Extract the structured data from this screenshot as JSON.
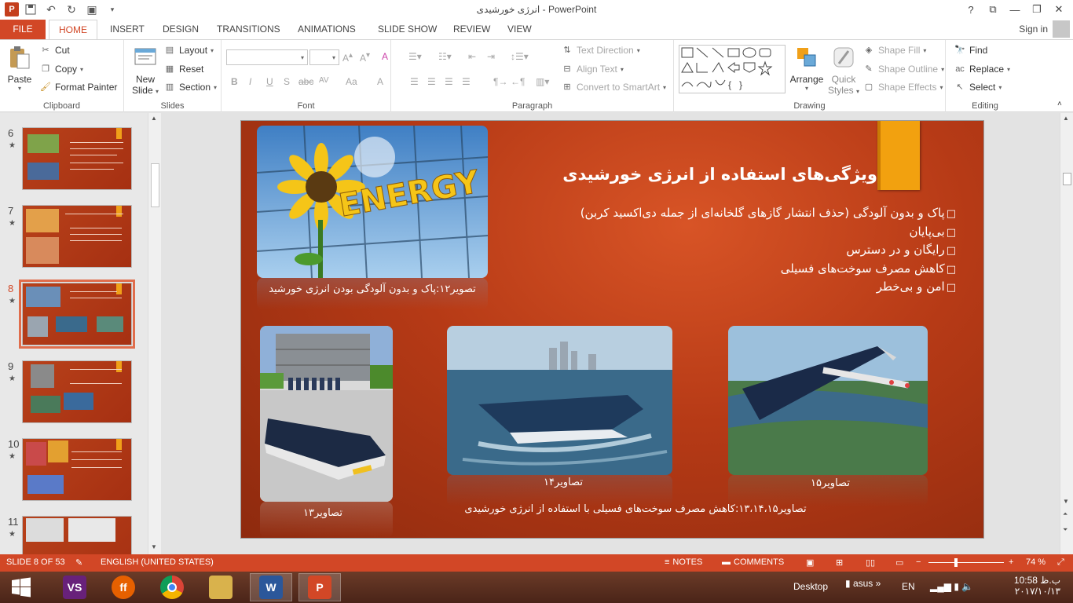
{
  "window": {
    "title": "انرژی خورشیدی - PowerPoint",
    "help": "?",
    "controls": [
      "⧉",
      "—",
      "❐",
      "✕"
    ]
  },
  "tabs": [
    "FILE",
    "HOME",
    "INSERT",
    "DESIGN",
    "TRANSITIONS",
    "ANIMATIONS",
    "SLIDE SHOW",
    "REVIEW",
    "VIEW"
  ],
  "signin": "Sign in",
  "ribbon": {
    "clipboard": {
      "label": "Clipboard",
      "paste": "Paste",
      "cut": "Cut",
      "copy": "Copy",
      "format_painter": "Format Painter"
    },
    "slides": {
      "label": "Slides",
      "new_slide_1": "New",
      "new_slide_2": "Slide",
      "layout": "Layout",
      "reset": "Reset",
      "section": "Section"
    },
    "font": {
      "label": "Font",
      "bold": "B",
      "italic": "I",
      "underline": "U",
      "shadow": "S",
      "strike": "abc",
      "spacing": "AV",
      "case": "Aa",
      "color": "A"
    },
    "paragraph": {
      "label": "Paragraph",
      "text_direction": "Text Direction",
      "align_text": "Align Text",
      "convert_smartart": "Convert to SmartArt"
    },
    "drawing": {
      "label": "Drawing",
      "arrange": "Arrange",
      "quick_styles_1": "Quick",
      "quick_styles_2": "Styles",
      "shape_fill": "Shape Fill",
      "shape_outline": "Shape Outline",
      "shape_effects": "Shape Effects"
    },
    "editing": {
      "label": "Editing",
      "find": "Find",
      "replace": "Replace",
      "select": "Select"
    }
  },
  "thumbnails": [
    {
      "num": "6",
      "selected": false
    },
    {
      "num": "7",
      "selected": false
    },
    {
      "num": "8",
      "selected": true
    },
    {
      "num": "9",
      "selected": false
    },
    {
      "num": "10",
      "selected": false
    },
    {
      "num": "11",
      "selected": false
    }
  ],
  "slide": {
    "title": "ویژگی‌های استفاده از انرژی خورشیدی",
    "bullets": [
      "پاک و بدون آلودگی (حذف انتشار گازهای گلخانه‌ای از جمله دی‌اکسید کربن)",
      "بی‌پایان",
      "رایگان و در دسترس",
      "کاهش مصرف سوخت‌های فسیلی",
      "امن و بی‌خطر"
    ],
    "energy_word": "ENERGY",
    "caption_12": "تصویر۱۲:پاک و بدون آلودگی بودن انرژی خورشید",
    "caption_13": "تصاویر۱۳",
    "caption_14": "تصاویر۱۴",
    "caption_15": "تصاویر۱۵",
    "caption_combined": "تصاویر۱۳،۱۴،۱۵:کاهش مصرف سوخت‌های فسیلی با استفاده از انرژی خورشیدی"
  },
  "status": {
    "slide_of": "SLIDE 8 OF 53",
    "language": "ENGLISH (UNITED STATES)",
    "notes": "NOTES",
    "comments": "COMMENTS",
    "zoom": "74 %",
    "zoom_level_percent": 74
  },
  "taskbar": {
    "desktop": "Desktop",
    "asus": "asus",
    "lang": "EN",
    "time": "10:58 ب.ظ",
    "date": "۲۰۱۷/۱۰/۱۳",
    "apps": [
      {
        "name": "visual-studio",
        "label": "VS",
        "color": "#68217a"
      },
      {
        "name": "firefox",
        "label": "ff",
        "color": "#e66000"
      },
      {
        "name": "chrome",
        "label": "◎",
        "color": "#1a73e8"
      },
      {
        "name": "file-explorer",
        "label": "📁",
        "color": "#d9b24c"
      },
      {
        "name": "word",
        "label": "W",
        "color": "#2b579a"
      },
      {
        "name": "powerpoint",
        "label": "P",
        "color": "#d24726"
      }
    ]
  },
  "colors": {
    "accent": "#d24726",
    "slide_bg": "#b63a16",
    "title_tab": "#f2a10f"
  }
}
